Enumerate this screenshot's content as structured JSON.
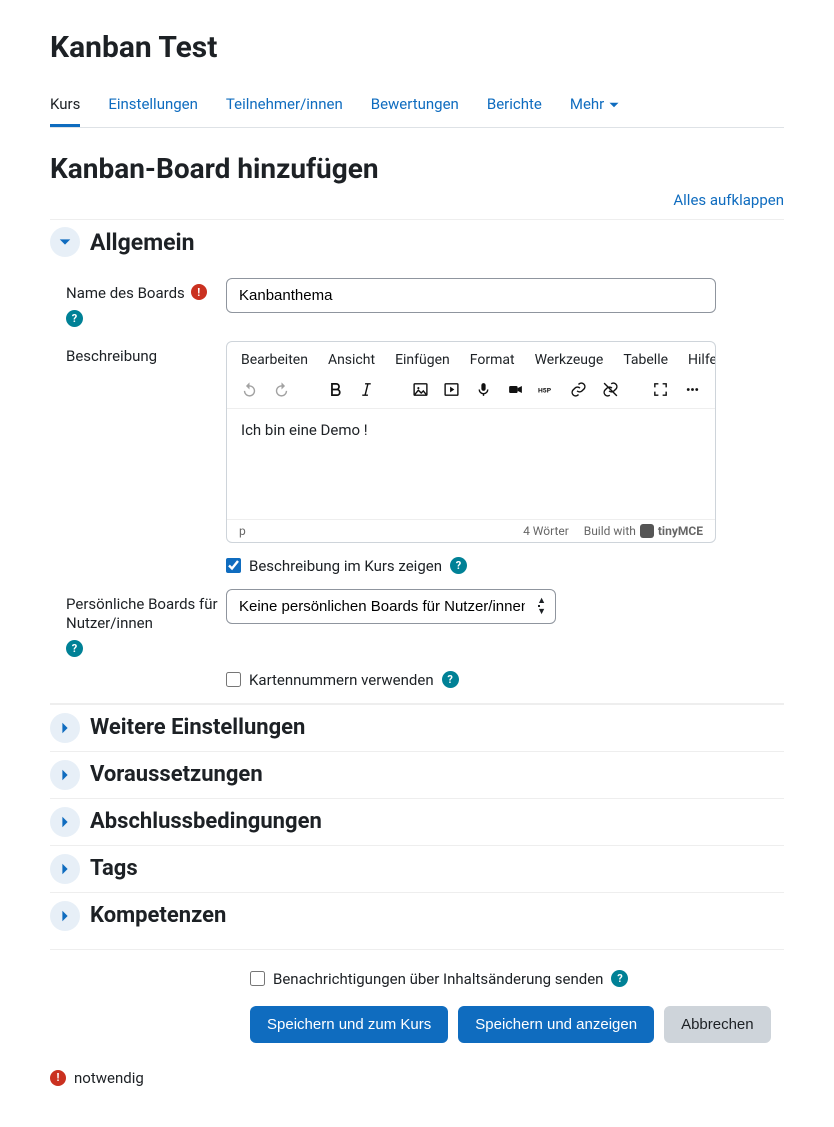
{
  "course_title": "Kanban Test",
  "tabs": {
    "items": [
      {
        "label": "Kurs",
        "active": true
      },
      {
        "label": "Einstellungen",
        "active": false
      },
      {
        "label": "Teilnehmer/innen",
        "active": false
      },
      {
        "label": "Bewertungen",
        "active": false
      },
      {
        "label": "Berichte",
        "active": false
      }
    ],
    "more_label": "Mehr"
  },
  "page_heading": "Kanban-Board hinzufügen",
  "expand_all_label": "Alles aufklappen",
  "sections": {
    "general": {
      "title": "Allgemein",
      "name_label": "Name des Boards",
      "name_value": "Kanbanthema",
      "desc_label": "Beschreibung",
      "editor": {
        "menu": [
          "Bearbeiten",
          "Ansicht",
          "Einfügen",
          "Format",
          "Werkzeuge",
          "Tabelle",
          "Hilfe"
        ],
        "content": "Ich bin eine Demo !",
        "status_path": "p",
        "word_count": "4 Wörter",
        "builtwith": "Build with",
        "brand": "tinyMCE"
      },
      "show_desc_label": "Beschreibung im Kurs zeigen",
      "show_desc_checked": true,
      "personal_boards_label": "Persönliche Boards für Nutzer/innen",
      "personal_boards_value": "Keine persönlichen Boards für Nutzer/innen",
      "card_numbers_label": "Kartennummern verwenden",
      "card_numbers_checked": false
    },
    "collapsed": [
      "Weitere Einstellungen",
      "Voraussetzungen",
      "Abschlussbedingungen",
      "Tags",
      "Kompetenzen"
    ]
  },
  "bottom": {
    "notify_label": "Benachrichtigungen über Inhaltsänderung senden",
    "notify_checked": false,
    "save_return": "Speichern und zum Kurs",
    "save_show": "Speichern und anzeigen",
    "cancel": "Abbrechen",
    "required_legend": "notwendig"
  }
}
